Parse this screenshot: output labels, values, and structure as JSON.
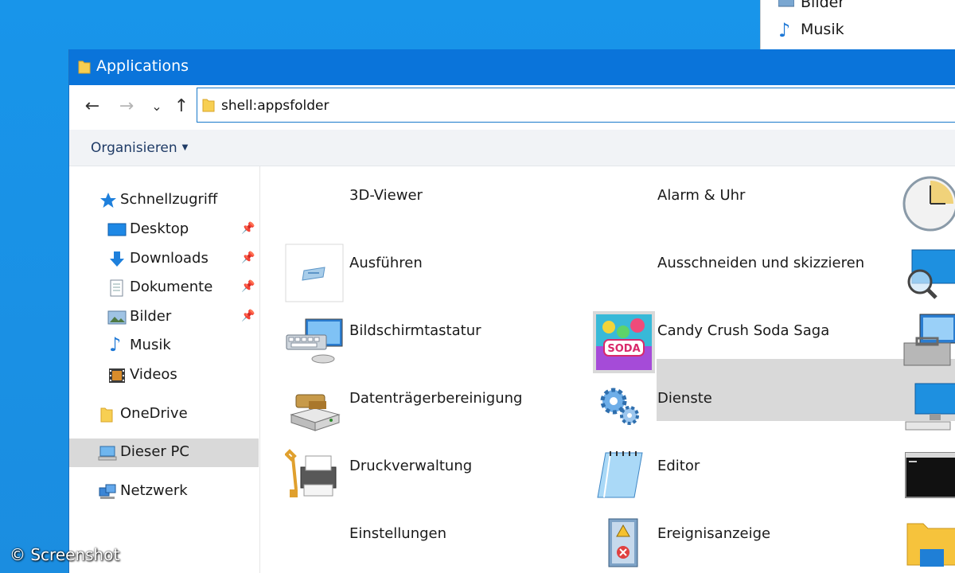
{
  "background_window": {
    "items": [
      {
        "label": "Bilder",
        "icon": "pictures-icon"
      },
      {
        "label": "Musik",
        "icon": "music-icon"
      }
    ]
  },
  "window": {
    "title": "Applications",
    "address": "shell:appsfolder",
    "title_color": "#0a74da"
  },
  "nav": {
    "back": "←",
    "forward": "→",
    "recent": "⌄",
    "up": "↑"
  },
  "command_bar": {
    "organize_label": "Organisieren"
  },
  "sidebar": {
    "items": [
      {
        "label": "Schnellzugriff",
        "icon": "star-icon"
      },
      {
        "label": "Desktop",
        "icon": "desktop-icon",
        "pinned": true
      },
      {
        "label": "Downloads",
        "icon": "download-icon",
        "pinned": true
      },
      {
        "label": "Dokumente",
        "icon": "documents-icon",
        "pinned": true
      },
      {
        "label": "Bilder",
        "icon": "pictures-icon",
        "pinned": true
      },
      {
        "label": "Musik",
        "icon": "music-icon"
      },
      {
        "label": "Videos",
        "icon": "videos-icon"
      },
      {
        "label": "OneDrive",
        "icon": "folder-icon"
      },
      {
        "label": "Dieser PC",
        "icon": "computer-icon",
        "selected": true
      },
      {
        "label": "Netzwerk",
        "icon": "network-icon"
      }
    ]
  },
  "apps": {
    "col1": [
      {
        "label": "3D-Viewer",
        "icon": "none"
      },
      {
        "label": "Ausführen",
        "icon": "run-icon"
      },
      {
        "label": "Bildschirmtastatur",
        "icon": "keyboard-icon"
      },
      {
        "label": "Datenträgerbereinigung",
        "icon": "disk-cleanup-icon"
      },
      {
        "label": "Druckverwaltung",
        "icon": "printer-icon"
      },
      {
        "label": "Einstellungen",
        "icon": "none"
      }
    ],
    "col2": [
      {
        "label": "Alarm & Uhr",
        "icon": "none"
      },
      {
        "label": "Ausschneiden und skizzieren",
        "icon": "none"
      },
      {
        "label": "Candy Crush Soda Saga",
        "icon": "candy-crush-icon",
        "selected": true
      },
      {
        "label": "Dienste",
        "icon": "gears-icon"
      },
      {
        "label": "Editor",
        "icon": "notepad-icon"
      },
      {
        "label": "Ereignisanzeige",
        "icon": "event-viewer-icon"
      }
    ],
    "col3_icons": [
      "clock-icon",
      "magnifier-monitor-icon",
      "toolbox-computer-icon",
      "computer-icon",
      "console-icon",
      "explorer-folder-icon"
    ]
  },
  "watermark": "© Screenshot"
}
